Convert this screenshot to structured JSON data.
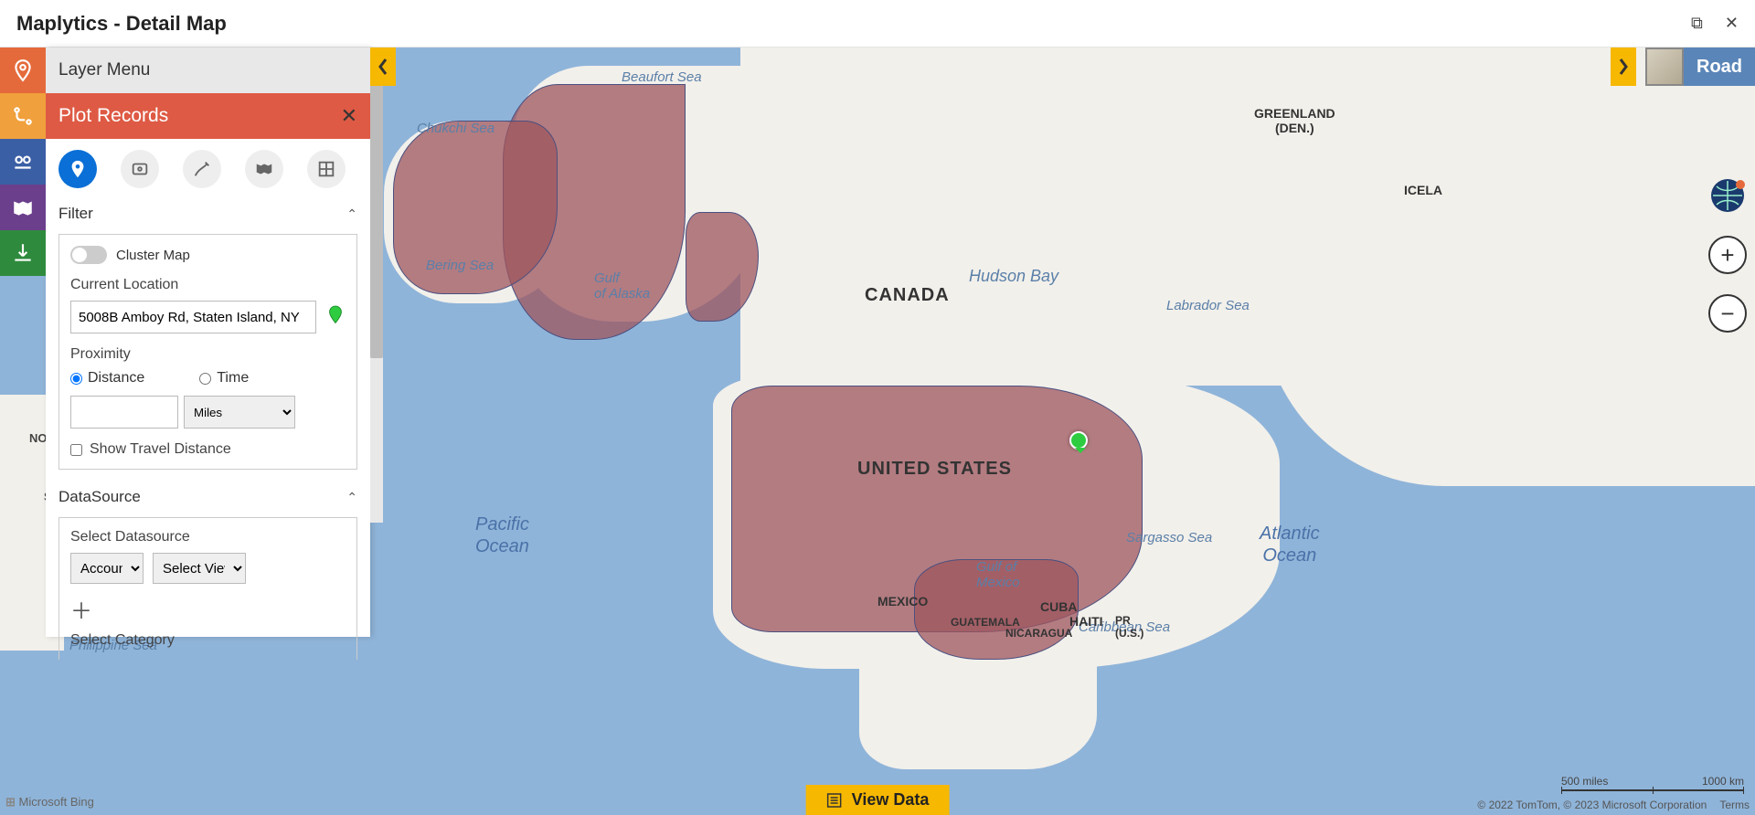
{
  "window": {
    "title": "Maplytics - Detail Map"
  },
  "leftRail": {
    "items": [
      {
        "name": "pin-icon"
      },
      {
        "name": "route-icon"
      },
      {
        "name": "layers-icon"
      },
      {
        "name": "territory-icon"
      },
      {
        "name": "download-icon"
      }
    ]
  },
  "panel": {
    "layerMenu": "Layer Menu",
    "plotRecords": "Plot Records",
    "tabs": [
      "pin-icon",
      "poi-icon",
      "draw-icon",
      "region-icon",
      "grid-icon"
    ],
    "filter": {
      "title": "Filter",
      "clusterMap": "Cluster Map",
      "currentLocationLabel": "Current Location",
      "currentLocation": "5008B Amboy Rd, Staten Island, NY",
      "proximityLabel": "Proximity",
      "distanceLabel": "Distance",
      "timeLabel": "Time",
      "proxValue": "",
      "proxUnit": "Miles",
      "showTravel": "Show Travel Distance"
    },
    "datasource": {
      "title": "DataSource",
      "selectDatasource": "Select Datasource",
      "entity": "Account",
      "view": "Select View",
      "selectCategory": "Select Category"
    }
  },
  "map": {
    "type": "Road",
    "seaLabels": {
      "beaufort": "Beaufort Sea",
      "chukchi": "Chukchi Sea",
      "bering": "Bering Sea",
      "gulfAlaska": "Gulf of Alaska",
      "hudson": "Hudson Bay",
      "labrador": "Labrador Sea",
      "sargasso": "Sargasso Sea",
      "caribbean": "Caribbean Sea",
      "gulfMexico": "Gulf of Mexico",
      "philippine": "Philippine Sea"
    },
    "oceanLabels": {
      "pacific": "Pacific Ocean",
      "atlantic": "Atlantic Ocean"
    },
    "countryLabels": {
      "canada": "CANADA",
      "usa": "UNITED STATES",
      "mexico": "MEXICO",
      "greenland": "GREENLAND (DEN.)",
      "cuba": "CUBA",
      "haiti": "HAITI",
      "pr": "PR (U.S.)",
      "nicaragua": "NICARAGUA",
      "guatemala": "GUATEMALA",
      "iceland": "ICELAND"
    },
    "partialLabels": {
      "no": "NO",
      "s": "S"
    },
    "viewData": "View Data",
    "scale": {
      "miles": "500 miles",
      "km": "1000 km"
    },
    "credits": {
      "copy": "© 2022 TomTom, © 2023 Microsoft Corporation",
      "terms": "Terms"
    },
    "bing": "Microsoft Bing"
  }
}
